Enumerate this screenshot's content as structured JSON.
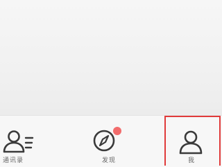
{
  "tab_bar": {
    "tabs": [
      {
        "label": "通讯录",
        "icon": "contacts-icon",
        "active": false
      },
      {
        "label": "发现",
        "icon": "compass-icon",
        "active": false,
        "badge": true
      },
      {
        "label": "我",
        "icon": "person-icon",
        "active": false,
        "highlighted": true
      }
    ]
  },
  "colors": {
    "badge": "#f26c6c",
    "highlight_box": "#e03a3a",
    "icon_stroke": "#3a3a3a",
    "label": "#666666"
  }
}
